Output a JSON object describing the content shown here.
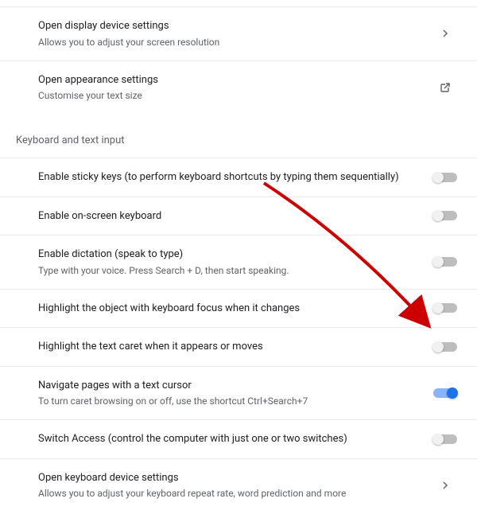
{
  "top_items": [
    {
      "title": "Open display device settings",
      "subtitle": "Allows you to adjust your screen resolution",
      "control": "chevron"
    },
    {
      "title": "Open appearance settings",
      "subtitle": "Customise your text size",
      "control": "external"
    }
  ],
  "section_header": "Keyboard and text input",
  "keyboard_items": [
    {
      "title": "Enable sticky keys (to perform keyboard shortcuts by typing them sequentially)",
      "subtitle": "",
      "control": "toggle",
      "on": false
    },
    {
      "title": "Enable on-screen keyboard",
      "subtitle": "",
      "control": "toggle",
      "on": false
    },
    {
      "title": "Enable dictation (speak to type)",
      "subtitle": "Type with your voice. Press Search + D, then start speaking.",
      "control": "toggle",
      "on": false
    },
    {
      "title": "Highlight the object with keyboard focus when it changes",
      "subtitle": "",
      "control": "toggle",
      "on": false
    },
    {
      "title": "Highlight the text caret when it appears or moves",
      "subtitle": "",
      "control": "toggle",
      "on": false
    },
    {
      "title": "Navigate pages with a text cursor",
      "subtitle": "To turn caret browsing on or off, use the shortcut Ctrl+Search+7",
      "control": "toggle",
      "on": true
    },
    {
      "title": "Switch Access (control the computer with just one or two switches)",
      "subtitle": "",
      "control": "toggle",
      "on": false
    },
    {
      "title": "Open keyboard device settings",
      "subtitle": "Allows you to adjust your keyboard repeat rate, word prediction and more",
      "control": "chevron"
    }
  ]
}
